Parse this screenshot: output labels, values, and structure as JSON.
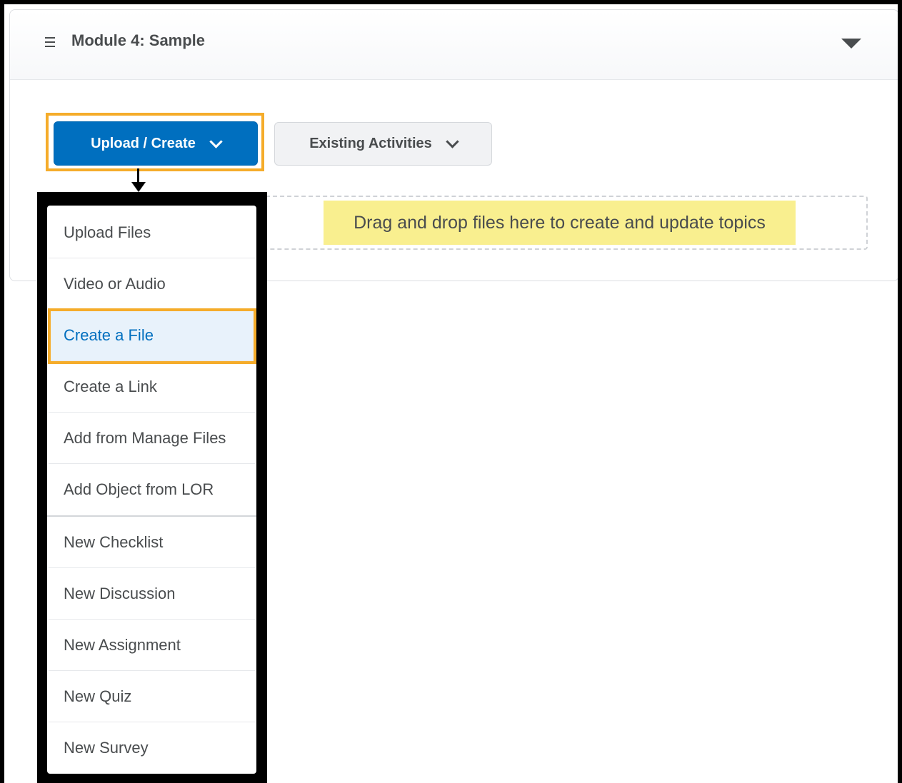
{
  "module": {
    "title": "Module 4: Sample"
  },
  "toolbar": {
    "upload_create_label": "Upload / Create",
    "existing_activities_label": "Existing Activities"
  },
  "dropzone": {
    "text": "Drag and drop files here to create and update topics"
  },
  "menu": {
    "items": [
      {
        "label": "Upload Files"
      },
      {
        "label": "Video or Audio"
      },
      {
        "label": "Create a File"
      },
      {
        "label": "Create a Link"
      },
      {
        "label": "Add from Manage Files"
      },
      {
        "label": "Add Object from LOR"
      },
      {
        "label": "New Checklist"
      },
      {
        "label": "New Discussion"
      },
      {
        "label": "New Assignment"
      },
      {
        "label": "New Quiz"
      },
      {
        "label": "New Survey"
      }
    ],
    "active_item": "Create a File"
  },
  "colors": {
    "primary": "#006fbf",
    "highlight": "#f5ac2a",
    "dropzone_highlight": "#f9ef8f"
  }
}
